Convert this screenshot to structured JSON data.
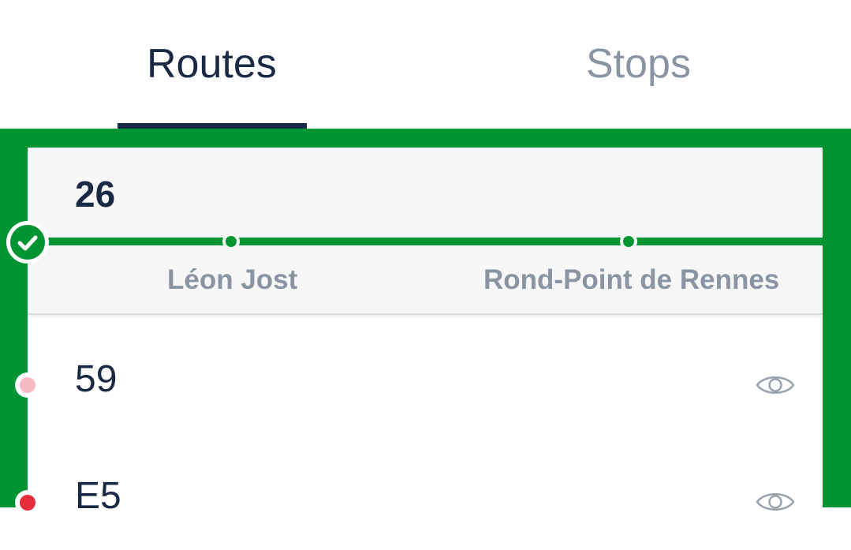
{
  "tabs": [
    {
      "label": "Routes",
      "active": true
    },
    {
      "label": "Stops",
      "active": false
    }
  ],
  "active_route": {
    "number": "26",
    "line_color": "#009432",
    "stops": [
      "Léon Jost",
      "Rond-Point de Rennes"
    ]
  },
  "routes": [
    {
      "number": "59",
      "dot_color": "#f7b9c4",
      "icon": "eye-icon"
    },
    {
      "number": "E5",
      "dot_color": "#e52d3b",
      "icon": "eye-icon"
    }
  ],
  "colors": {
    "accent": "#009432",
    "text_primary": "#1a2a44",
    "text_muted": "#8a94a3",
    "icon": "#9aa3ad"
  }
}
